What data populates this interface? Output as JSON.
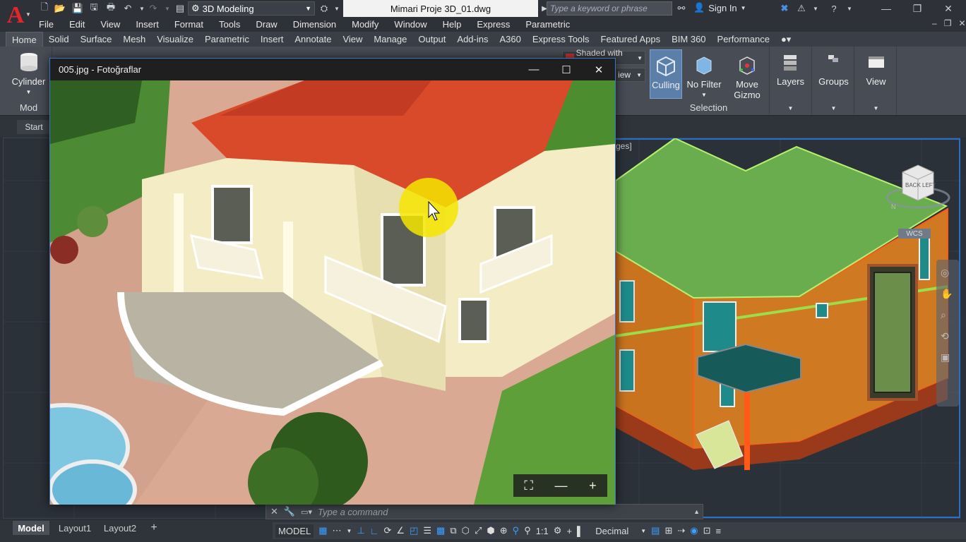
{
  "app": {
    "logo_letter": "A",
    "document_title": "Mimari Proje 3D_01.dwg",
    "accent": "#e3262b"
  },
  "workspace": {
    "label": "3D Modeling"
  },
  "search": {
    "placeholder": "Type a keyword or phrase"
  },
  "account": {
    "sign_in": "Sign In"
  },
  "menubar": {
    "items": [
      "File",
      "Edit",
      "View",
      "Insert",
      "Format",
      "Tools",
      "Draw",
      "Dimension",
      "Modify",
      "Window",
      "Help",
      "Express",
      "Parametric"
    ]
  },
  "ribbon_tabs": {
    "items": [
      "Home",
      "Solid",
      "Surface",
      "Mesh",
      "Visualize",
      "Parametric",
      "Insert",
      "Annotate",
      "View",
      "Manage",
      "Output",
      "Add-ins",
      "A360",
      "Express Tools",
      "Featured Apps",
      "BIM 360",
      "Performance"
    ],
    "active": "Home"
  },
  "ribbon": {
    "cylinder": "Cylinder",
    "modeling_panel": "Mod",
    "visual_style": "Shaded with e...",
    "view_dropdown": "iew",
    "culling": "Culling",
    "no_filter": "No Filter",
    "move_gizmo": "Move\nGizmo",
    "selection_panel": "Selection",
    "layers": "Layers",
    "groups": "Groups",
    "view": "View"
  },
  "file_tabs": {
    "start": "Start"
  },
  "viewport": {
    "label": "ges]",
    "viewcube_top": "BACK",
    "viewcube_side": "LEFT",
    "compass": "N",
    "wcs": "WCS"
  },
  "photo_viewer": {
    "title": "005.jpg - Fotoğraflar"
  },
  "command": {
    "placeholder": "Type a command"
  },
  "layout_tabs": {
    "items": [
      "Model",
      "Layout1",
      "Layout2"
    ],
    "add": "+"
  },
  "status": {
    "model": "MODEL",
    "scale": "1:1",
    "units": "Decimal"
  }
}
